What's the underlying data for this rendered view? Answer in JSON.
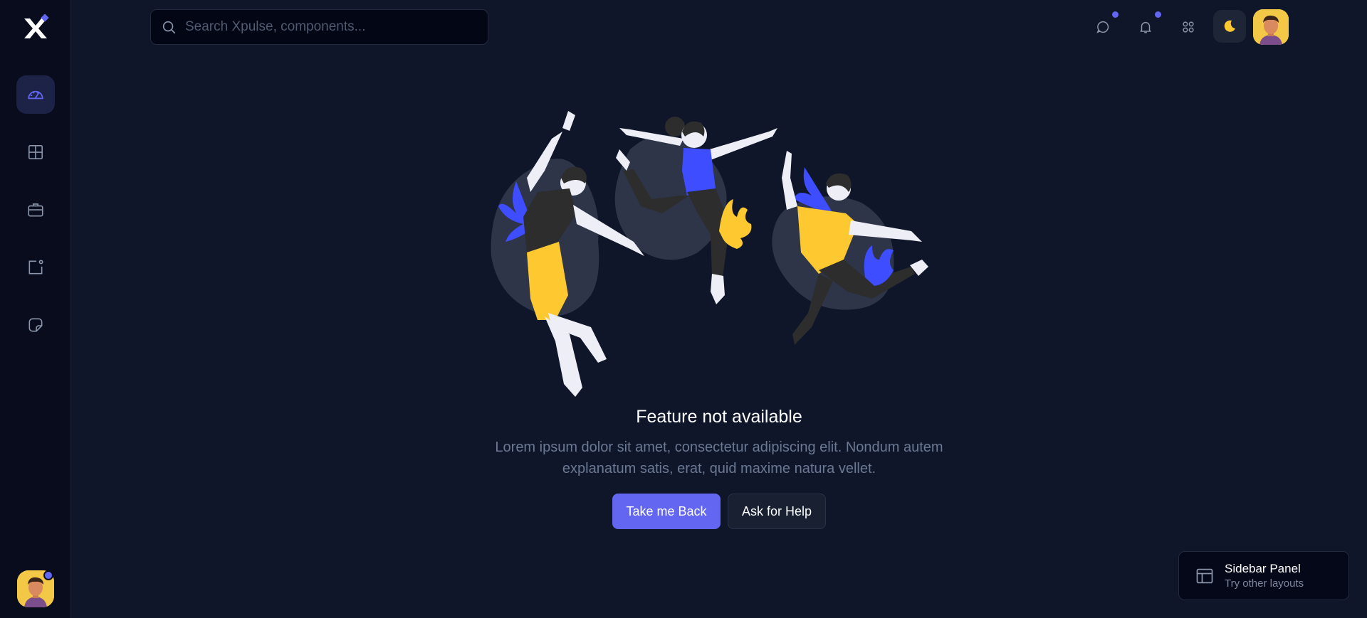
{
  "search": {
    "placeholder": "Search Xpulse, components..."
  },
  "sidebar": {
    "items": [
      {
        "name": "dashboard",
        "icon": "gauge-icon",
        "active": true
      },
      {
        "name": "layouts",
        "icon": "grid-icon",
        "active": false
      },
      {
        "name": "work",
        "icon": "briefcase-icon",
        "active": false
      },
      {
        "name": "notifications",
        "icon": "notification-square-icon",
        "active": false
      },
      {
        "name": "notes",
        "icon": "sticky-note-icon",
        "active": false
      }
    ]
  },
  "header": {
    "icons": [
      "chat-icon",
      "bell-icon",
      "apps-icon",
      "moon-icon"
    ]
  },
  "main": {
    "title": "Feature not available",
    "description": "Lorem ipsum dolor sit amet, consectetur adipiscing elit. Nondum autem explanatum satis, erat, quid maxime natura vellet.",
    "primary_button": "Take me Back",
    "secondary_button": "Ask for Help"
  },
  "panel_switcher": {
    "title": "Sidebar Panel",
    "subtitle": "Try other layouts"
  },
  "colors": {
    "background": "#0f1629",
    "sidebar": "#080c1d",
    "accent": "#6366f1",
    "yellow": "#fdc830",
    "blue": "#3d4dff"
  }
}
